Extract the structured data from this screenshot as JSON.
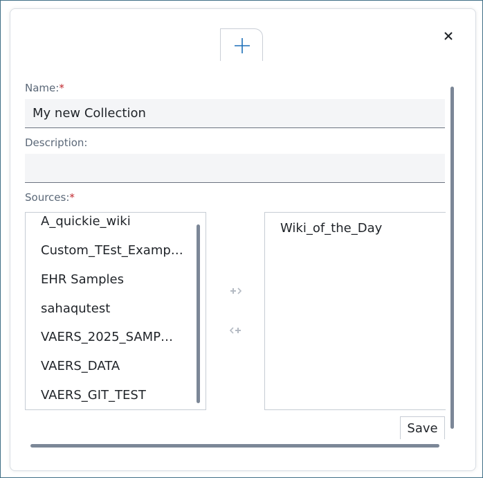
{
  "dialog": {
    "close_symbol": "✕"
  },
  "form": {
    "name": {
      "label": "Name:",
      "required_mark": "*",
      "value": "My new Collection"
    },
    "description": {
      "label": "Description:",
      "value": ""
    },
    "sources": {
      "label": "Sources:",
      "required_mark": "*",
      "available": [
        "A_quickie_wiki",
        "Custom_TEst_Examp…",
        "EHR Samples",
        "sahaqutest",
        "VAERS_2025_SAMP…",
        "VAERS_DATA",
        "VAERS_GIT_TEST"
      ],
      "selected": [
        "Wiki_of_the_Day"
      ]
    }
  },
  "actions": {
    "save_label": "Save"
  },
  "icons": {
    "add": "plus-icon",
    "close": "close-icon",
    "move_right": "move-right-icon",
    "move_left": "move-left-icon"
  },
  "colors": {
    "accent": "#1c6fb8",
    "required": "#c0282e",
    "label": "#5b6878",
    "scrollbar": "#7c8797"
  }
}
